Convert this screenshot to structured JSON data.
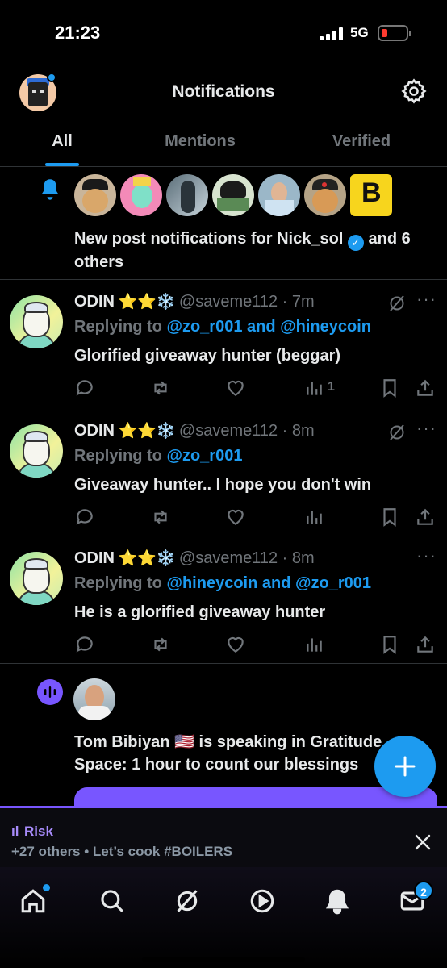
{
  "status_bar": {
    "time": "21:23",
    "network": "5G"
  },
  "header": {
    "title": "Notifications"
  },
  "tabs": [
    {
      "label": "All",
      "active": true
    },
    {
      "label": "Mentions",
      "active": false
    },
    {
      "label": "Verified",
      "active": false
    }
  ],
  "post_notification": {
    "text_before": "New post notifications for Nick_sol",
    "text_after": "and 6 others",
    "avatar_count": 7
  },
  "replies": [
    {
      "name": "ODIN",
      "emojis": "⭐⭐❄️",
      "handle": "@saveme112 · 7m",
      "replying_prefix": "Replying to",
      "replying_to": "@zo_r001 and @hineycoin",
      "text": "Glorified giveaway hunter (beggar)",
      "views": "1"
    },
    {
      "name": "ODIN",
      "emojis": "⭐⭐❄️",
      "handle": "@saveme112 · 8m",
      "replying_prefix": "Replying to",
      "replying_to": "@zo_r001",
      "text": "Giveaway hunter.. I hope you don't win",
      "views": ""
    },
    {
      "name": "ODIN",
      "emojis": "⭐⭐❄️",
      "handle": "@saveme112 · 8m",
      "replying_prefix": "Replying to",
      "replying_to": "@hineycoin and @zo_r001",
      "text": "He is a glorified giveaway hunter",
      "views": ""
    }
  ],
  "space": {
    "line1": "Tom Bibiyan 🇺🇸 is speaking in Gratitude",
    "line2": "Space: 1 hour to count our blessings"
  },
  "dock": {
    "title": "Risk",
    "subtitle": "+27 others • Let’s cook #BOILERS"
  },
  "nav": {
    "messages_badge": "2"
  },
  "colors": {
    "accent": "#1d9bf0",
    "spaces": "#7856ff",
    "background": "#000000",
    "muted": "#71767b"
  }
}
